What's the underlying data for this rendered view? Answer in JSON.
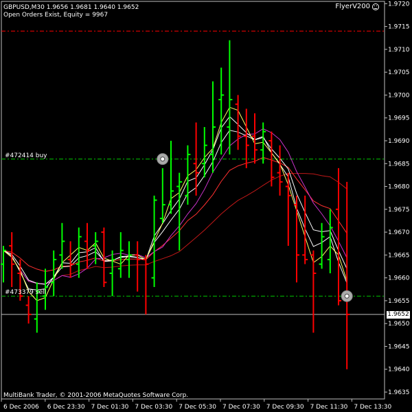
{
  "header": {
    "symbol_line": "GBPUSD,M30  1.9656 1.9681 1.9640 1.9652",
    "status_line": "Open Orders Exist, Equity = 9967",
    "expert": "FlyerV200"
  },
  "orders": [
    {
      "label": "#472414 buy",
      "price": 1.9686
    },
    {
      "label": "#473379 sell",
      "price": 1.9656
    }
  ],
  "levels": {
    "red_dashed": 1.9714,
    "current": 1.9652,
    "current_label": "1.9652"
  },
  "footer": "MultiBank Trader, © 2001-2006 MetaQuotes Software Corp.",
  "colors": {
    "bull": "#00ff00",
    "bear": "#ff0000",
    "ma_white": "#ffffff",
    "ma_yellow": "#ffff66",
    "ma_magenta": "#cc33cc",
    "ma_red": "#ff3030",
    "ma_darkred": "#c01818",
    "order_line": "#00c800",
    "red_line": "#ff0000",
    "grid": "#c0c0c0"
  },
  "chart_data": {
    "type": "ohlc",
    "y_ticks": [
      "1.9720",
      "1.9715",
      "1.9710",
      "1.9705",
      "1.9700",
      "1.9695",
      "1.9690",
      "1.9685",
      "1.9680",
      "1.9675",
      "1.9670",
      "1.9665",
      "1.9660",
      "1.9655",
      "1.9650",
      "1.9645",
      "1.9640",
      "1.9635"
    ],
    "x_ticks": [
      "6 Dec 2006",
      "6 Dec 23:30",
      "7 Dec 01:30",
      "7 Dec 03:30",
      "7 Dec 05:30",
      "7 Dec 07:30",
      "7 Dec 09:30",
      "7 Dec 11:30",
      "7 Dec 13:30"
    ],
    "bars": [
      {
        "o": 1.9663,
        "h": 1.9667,
        "l": 1.9659,
        "c": 1.9666
      },
      {
        "o": 1.9667,
        "h": 1.967,
        "l": 1.9658,
        "c": 1.9663
      },
      {
        "o": 1.9661,
        "h": 1.9664,
        "l": 1.9655,
        "c": 1.9656
      },
      {
        "o": 1.9654,
        "h": 1.9656,
        "l": 1.965,
        "c": 1.9652
      },
      {
        "o": 1.9651,
        "h": 1.9659,
        "l": 1.9648,
        "c": 1.9657
      },
      {
        "o": 1.9656,
        "h": 1.9662,
        "l": 1.9653,
        "c": 1.9658
      },
      {
        "o": 1.9659,
        "h": 1.9666,
        "l": 1.9656,
        "c": 1.9664
      },
      {
        "o": 1.9665,
        "h": 1.9672,
        "l": 1.9662,
        "c": 1.9668
      },
      {
        "o": 1.9664,
        "h": 1.9668,
        "l": 1.966,
        "c": 1.9663
      },
      {
        "o": 1.9663,
        "h": 1.9671,
        "l": 1.966,
        "c": 1.9669
      },
      {
        "o": 1.9668,
        "h": 1.9672,
        "l": 1.9662,
        "c": 1.9666
      },
      {
        "o": 1.9667,
        "h": 1.967,
        "l": 1.9663,
        "c": 1.9668
      },
      {
        "o": 1.967,
        "h": 1.9671,
        "l": 1.9658,
        "c": 1.9659
      },
      {
        "o": 1.9661,
        "h": 1.9666,
        "l": 1.9656,
        "c": 1.9664
      },
      {
        "o": 1.9662,
        "h": 1.967,
        "l": 1.966,
        "c": 1.9666
      },
      {
        "o": 1.9664,
        "h": 1.9668,
        "l": 1.966,
        "c": 1.9665
      },
      {
        "o": 1.9665,
        "h": 1.9668,
        "l": 1.9657,
        "c": 1.9664
      },
      {
        "o": 1.9664,
        "h": 1.9665,
        "l": 1.9652,
        "c": 1.9663
      },
      {
        "o": 1.966,
        "h": 1.9678,
        "l": 1.9658,
        "c": 1.9677
      },
      {
        "o": 1.9673,
        "h": 1.9684,
        "l": 1.9672,
        "c": 1.9676
      },
      {
        "o": 1.9676,
        "h": 1.969,
        "l": 1.9674,
        "c": 1.9679
      },
      {
        "o": 1.968,
        "h": 1.9683,
        "l": 1.9666,
        "c": 1.9681
      },
      {
        "o": 1.9678,
        "h": 1.9689,
        "l": 1.9676,
        "c": 1.9687
      },
      {
        "o": 1.9685,
        "h": 1.9694,
        "l": 1.9678,
        "c": 1.9683
      },
      {
        "o": 1.9685,
        "h": 1.9693,
        "l": 1.9682,
        "c": 1.9689
      },
      {
        "o": 1.9687,
        "h": 1.9703,
        "l": 1.9683,
        "c": 1.9693
      },
      {
        "o": 1.9699,
        "h": 1.9706,
        "l": 1.9687,
        "c": 1.97
      },
      {
        "o": 1.9693,
        "h": 1.9712,
        "l": 1.9687,
        "c": 1.9699
      },
      {
        "o": 1.9698,
        "h": 1.97,
        "l": 1.9688,
        "c": 1.9691
      },
      {
        "o": 1.9691,
        "h": 1.9697,
        "l": 1.9684,
        "c": 1.9689
      },
      {
        "o": 1.9691,
        "h": 1.9696,
        "l": 1.9685,
        "c": 1.9688
      },
      {
        "o": 1.9688,
        "h": 1.9694,
        "l": 1.9685,
        "c": 1.9692
      },
      {
        "o": 1.969,
        "h": 1.9692,
        "l": 1.968,
        "c": 1.9682
      },
      {
        "o": 1.9683,
        "h": 1.9689,
        "l": 1.9678,
        "c": 1.9681
      },
      {
        "o": 1.968,
        "h": 1.9683,
        "l": 1.9667,
        "c": 1.9678
      },
      {
        "o": 1.9676,
        "h": 1.9678,
        "l": 1.9659,
        "c": 1.9665
      },
      {
        "o": 1.9665,
        "h": 1.9678,
        "l": 1.9663,
        "c": 1.9664
      },
      {
        "o": 1.9665,
        "h": 1.9666,
        "l": 1.9648,
        "c": 1.9661
      },
      {
        "o": 1.9663,
        "h": 1.9672,
        "l": 1.9662,
        "c": 1.9669
      },
      {
        "o": 1.9664,
        "h": 1.9675,
        "l": 1.9661,
        "c": 1.9671
      },
      {
        "o": 1.9675,
        "h": 1.9684,
        "l": 1.9654,
        "c": 1.9655
      },
      {
        "o": 1.9656,
        "h": 1.9681,
        "l": 1.964,
        "c": 1.9652
      }
    ],
    "ylim": [
      1.96335,
      1.97205
    ]
  }
}
